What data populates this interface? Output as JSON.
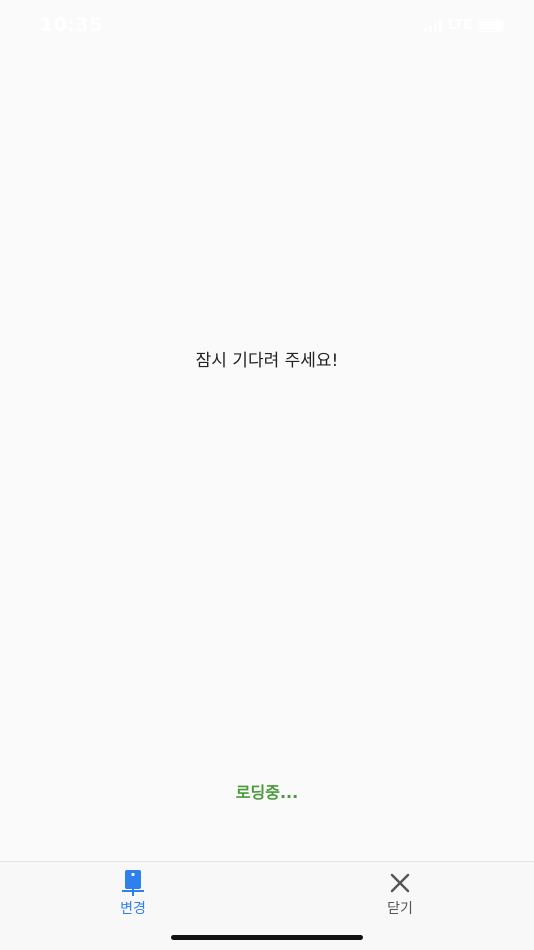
{
  "status_bar": {
    "time": "10:35",
    "network": "LTE"
  },
  "main": {
    "wait_message": "잠시 기다려 주세요!",
    "loading_text": "로딩중..."
  },
  "tab_bar": {
    "tabs": [
      {
        "label": "변경",
        "icon": "phone-swap-icon",
        "color": "#2f80ed",
        "active": true
      },
      {
        "label": "닫기",
        "icon": "close-icon",
        "color": "#555555",
        "active": false
      }
    ]
  },
  "colors": {
    "background": "#fafafa",
    "accent": "#2f80ed",
    "loading": "#4a9a3c"
  }
}
